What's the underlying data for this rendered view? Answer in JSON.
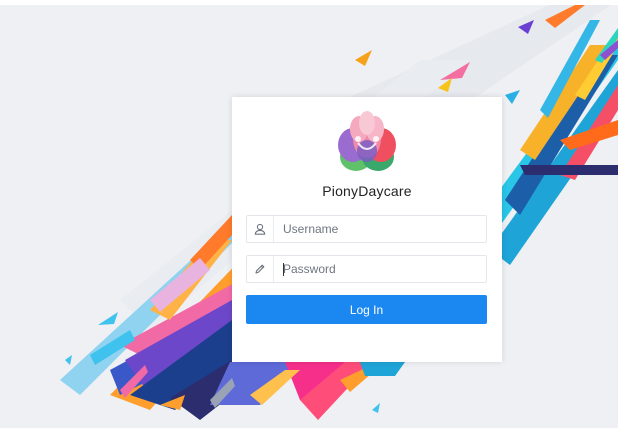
{
  "brand": {
    "name": "PionyDaycare"
  },
  "login": {
    "username_placeholder": "Username",
    "username_value": "",
    "password_placeholder": "Password",
    "password_value": "",
    "button_label": "Log In"
  },
  "icons": {
    "username": "user-icon",
    "password": "pencil-icon"
  },
  "colors": {
    "primary": "#1b88f2",
    "background": "#eef0f4",
    "card": "#ffffff"
  }
}
